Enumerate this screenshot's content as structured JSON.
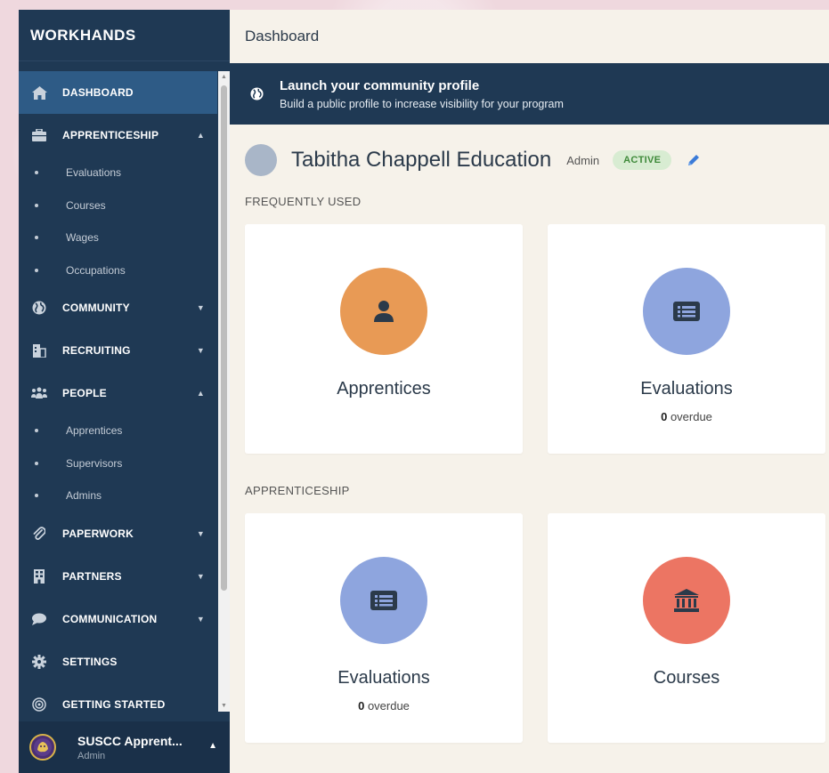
{
  "sidebar": {
    "brand": "WORKHANDS",
    "items": [
      {
        "label": "DASHBOARD",
        "icon": "home-icon",
        "active": true
      },
      {
        "label": "APPRENTICESHIP",
        "icon": "briefcase-icon",
        "expanded": true,
        "children": [
          "Evaluations",
          "Courses",
          "Wages",
          "Occupations"
        ]
      },
      {
        "label": "COMMUNITY",
        "icon": "globe-icon",
        "expanded": false
      },
      {
        "label": "RECRUITING",
        "icon": "building-icon",
        "expanded": false
      },
      {
        "label": "PEOPLE",
        "icon": "users-icon",
        "expanded": true,
        "children": [
          "Apprentices",
          "Supervisors",
          "Admins"
        ]
      },
      {
        "label": "PAPERWORK",
        "icon": "paperclip-icon",
        "expanded": false
      },
      {
        "label": "PARTNERS",
        "icon": "office-icon",
        "expanded": false
      },
      {
        "label": "COMMUNICATION",
        "icon": "chat-icon",
        "expanded": false
      },
      {
        "label": "SETTINGS",
        "icon": "gear-icon"
      },
      {
        "label": "GETTING STARTED",
        "icon": "target-icon"
      }
    ],
    "account": {
      "name": "SUSCC Apprent...",
      "role": "Admin"
    }
  },
  "header": {
    "title": "Dashboard"
  },
  "banner": {
    "title": "Launch your community profile",
    "subtitle": "Build a public profile to increase visibility for your program",
    "icon": "globe-icon"
  },
  "org": {
    "name": "Tabitha Chappell Education",
    "role": "Admin",
    "status": "ACTIVE"
  },
  "sections": {
    "frequently_used": {
      "label": "FREQUENTLY USED",
      "cards": [
        {
          "title": "Apprentices",
          "icon": "person-icon",
          "color": "#e89a55"
        },
        {
          "title": "Evaluations",
          "icon": "list-icon",
          "color": "#8ea5de",
          "count": "0",
          "count_label": "overdue"
        }
      ]
    },
    "apprenticeship": {
      "label": "APPRENTICESHIP",
      "cards": [
        {
          "title": "Evaluations",
          "icon": "list-icon",
          "color": "#8ea5de",
          "count": "0",
          "count_label": "overdue"
        },
        {
          "title": "Courses",
          "icon": "bank-icon",
          "color": "#ec7563"
        }
      ]
    }
  },
  "colors": {
    "sidebar": "#1f3954",
    "active_nav": "#2e5b86",
    "main_bg": "#f6f2ea",
    "badge_bg": "#d8ecd2",
    "badge_text": "#3f8a3a",
    "edit": "#3b7bd8"
  }
}
